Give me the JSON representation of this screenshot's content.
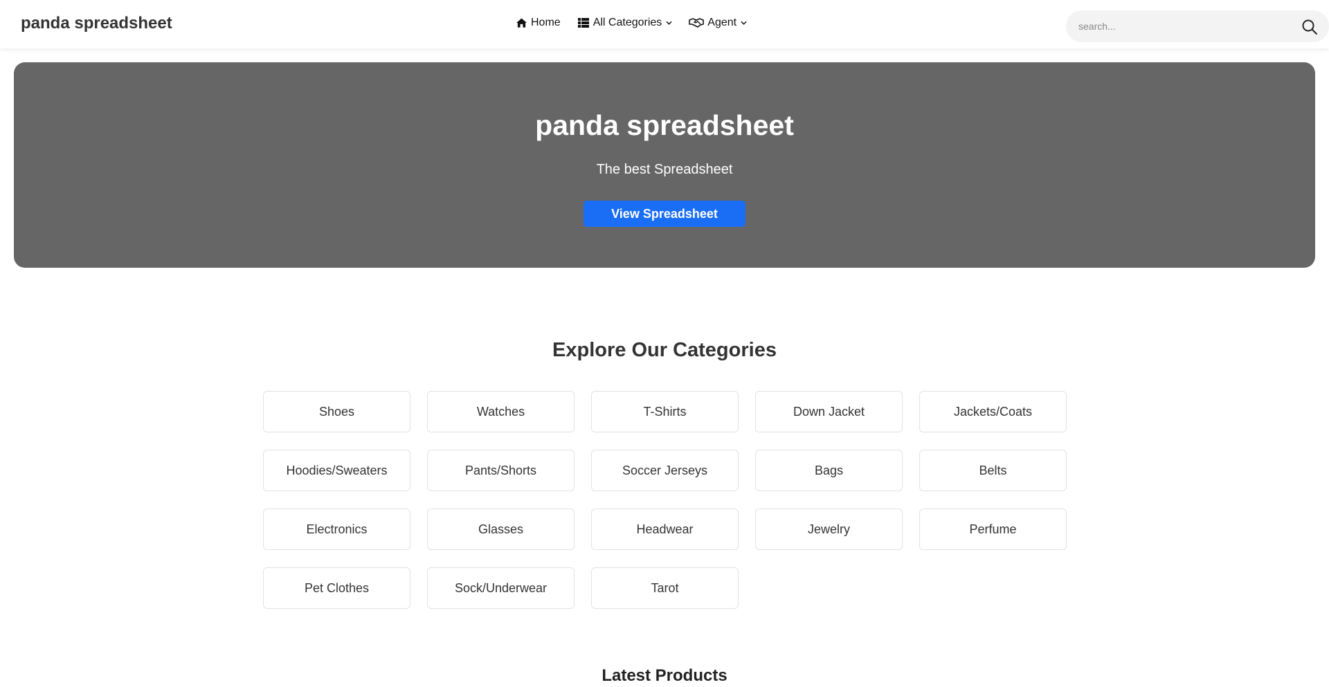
{
  "header": {
    "logo": "panda spreadsheet",
    "nav": [
      {
        "label": "Home",
        "icon": "home-icon",
        "dropdown": false
      },
      {
        "label": "All Categories",
        "icon": "grid-list-icon",
        "dropdown": true
      },
      {
        "label": "Agent",
        "icon": "handshake-icon",
        "dropdown": true
      }
    ],
    "search_placeholder": "search...",
    "search_icon": "search-icon"
  },
  "hero": {
    "title": "panda spreadsheet",
    "subtitle": "The best Spreadsheet",
    "button_label": "View Spreadsheet"
  },
  "categories": {
    "title": "Explore Our Categories",
    "items": [
      "Shoes",
      "Watches",
      "T-Shirts",
      "Down Jacket",
      "Jackets/Coats",
      "Hoodies/Sweaters",
      "Pants/Shorts",
      "Soccer Jerseys",
      "Bags",
      "Belts",
      "Electronics",
      "Glasses",
      "Headwear",
      "Jewelry",
      "Perfume",
      "Pet Clothes",
      "Sock/Underwear",
      "Tarot"
    ]
  },
  "latest": {
    "title": "Latest Products"
  },
  "colors": {
    "hero_bg": "#666666",
    "button_bg": "#1a6ef5",
    "search_bg": "#f3f3f3"
  }
}
